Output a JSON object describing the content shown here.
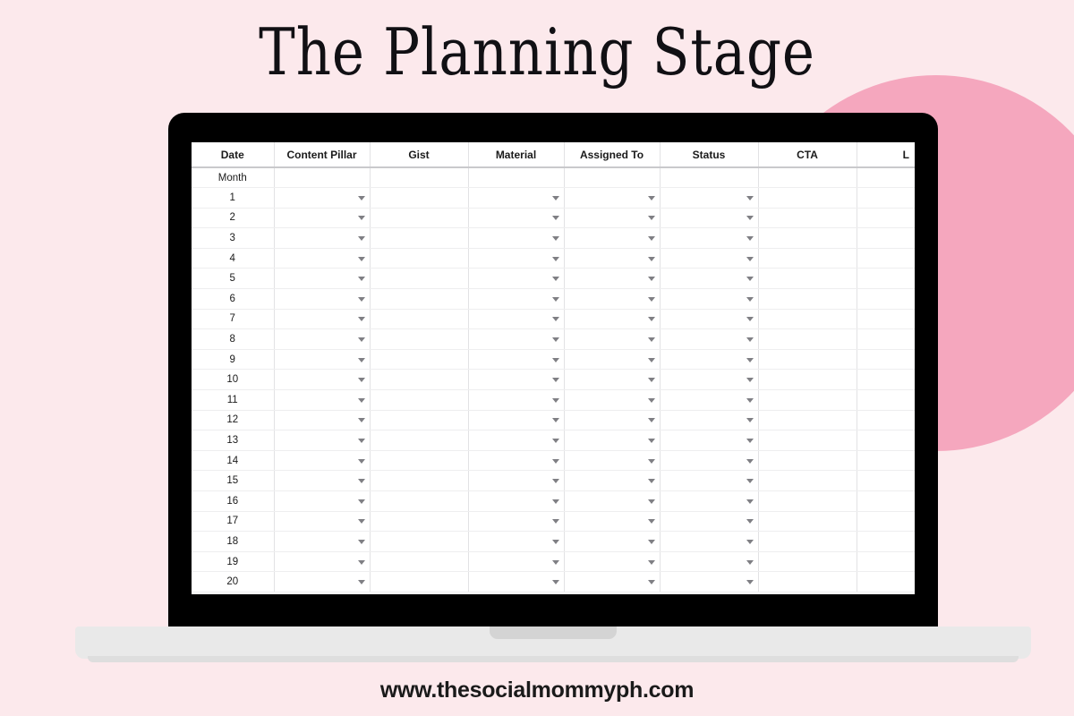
{
  "page": {
    "title": "The Planning Stage",
    "footer_url": "www.thesocialmommyph.com",
    "background_color": "#fce9ec",
    "accent_circle_color": "#f5a7be",
    "bezel_color": "#000000",
    "base_color": "#e9e9e9"
  },
  "spreadsheet": {
    "columns": [
      {
        "label": "Date",
        "has_dropdown": false
      },
      {
        "label": "Content Pillar",
        "has_dropdown": true
      },
      {
        "label": "Gist",
        "has_dropdown": false
      },
      {
        "label": "Material",
        "has_dropdown": true
      },
      {
        "label": "Assigned To",
        "has_dropdown": true
      },
      {
        "label": "Status",
        "has_dropdown": true
      },
      {
        "label": "CTA",
        "has_dropdown": false
      },
      {
        "label": "L",
        "has_dropdown": false
      }
    ],
    "month_row_label": "Month",
    "row_labels": [
      "1",
      "2",
      "3",
      "4",
      "5",
      "6",
      "7",
      "8",
      "9",
      "10",
      "11",
      "12",
      "13",
      "14",
      "15",
      "16",
      "17",
      "18",
      "19",
      "20"
    ]
  }
}
